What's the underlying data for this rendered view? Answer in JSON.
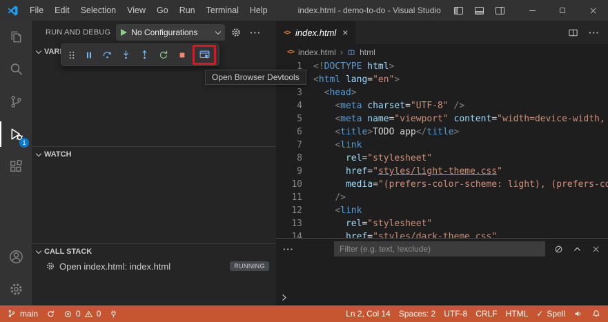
{
  "colors": {
    "status_bar_background": "#C65531",
    "badge_background": "#0A7ACC",
    "annotation_red": "#E81123"
  },
  "title_bar": {
    "app_title": "index.html - demo-to-do - Visual Studio C...",
    "menus": [
      "File",
      "Edit",
      "Selection",
      "View",
      "Go",
      "Run",
      "Terminal",
      "Help"
    ]
  },
  "activity_bar": {
    "debug_badge": "1"
  },
  "sidebar": {
    "title": "RUN AND DEBUG",
    "launch_dropdown": {
      "label": "No Configurations"
    },
    "variables_header": "VARIABLES",
    "watch_header": "WATCH",
    "call_stack_header": "CALL STACK",
    "call_stack_item": {
      "label": "Open index.html: index.html",
      "status": "RUNNING"
    }
  },
  "debug_toolbar": {
    "tooltip": "Open Browser Devtools"
  },
  "editor": {
    "tab_label": "index.html",
    "tab_close": "×",
    "breadcrumb_file": "index.html",
    "breadcrumb_separator": "›",
    "breadcrumb_symbol": "html",
    "file_icon_glyph": "<>",
    "more_actions_glyph": "···",
    "code_lines": [
      {
        "n": "1",
        "t": [
          [
            "p",
            "<!"
          ],
          [
            "tag",
            "DOCTYPE"
          ],
          [
            "txt",
            " "
          ],
          [
            "attr",
            "html"
          ],
          [
            "p",
            ">"
          ]
        ]
      },
      {
        "n": "2",
        "t": [
          [
            "p",
            "<"
          ],
          [
            "tag",
            "html"
          ],
          [
            "txt",
            " "
          ],
          [
            "attr",
            "lang"
          ],
          [
            "eq",
            "="
          ],
          [
            "str",
            "\"en\""
          ],
          [
            "p",
            ">"
          ]
        ]
      },
      {
        "n": "3",
        "t": [
          [
            "txt",
            "  "
          ],
          [
            "p",
            "<"
          ],
          [
            "tag",
            "head"
          ],
          [
            "p",
            ">"
          ]
        ]
      },
      {
        "n": "4",
        "t": [
          [
            "txt",
            "    "
          ],
          [
            "p",
            "<"
          ],
          [
            "tag",
            "meta"
          ],
          [
            "txt",
            " "
          ],
          [
            "attr",
            "charset"
          ],
          [
            "eq",
            "="
          ],
          [
            "str",
            "\"UTF-8\""
          ],
          [
            "txt",
            " "
          ],
          [
            "p",
            "/>"
          ]
        ]
      },
      {
        "n": "5",
        "t": [
          [
            "txt",
            "    "
          ],
          [
            "p",
            "<"
          ],
          [
            "tag",
            "meta"
          ],
          [
            "txt",
            " "
          ],
          [
            "attr",
            "name"
          ],
          [
            "eq",
            "="
          ],
          [
            "str",
            "\"viewport\""
          ],
          [
            "txt",
            " "
          ],
          [
            "attr",
            "content"
          ],
          [
            "eq",
            "="
          ],
          [
            "str",
            "\"width=device-width,"
          ]
        ]
      },
      {
        "n": "6",
        "t": [
          [
            "txt",
            "    "
          ],
          [
            "p",
            "<"
          ],
          [
            "tag",
            "title"
          ],
          [
            "p",
            ">"
          ],
          [
            "txt",
            "TODO app"
          ],
          [
            "p",
            "</"
          ],
          [
            "tag",
            "title"
          ],
          [
            "p",
            ">"
          ]
        ]
      },
      {
        "n": "7",
        "t": [
          [
            "txt",
            "    "
          ],
          [
            "p",
            "<"
          ],
          [
            "tag",
            "link"
          ]
        ]
      },
      {
        "n": "8",
        "t": [
          [
            "txt",
            "      "
          ],
          [
            "attr",
            "rel"
          ],
          [
            "eq",
            "="
          ],
          [
            "str",
            "\"stylesheet\""
          ]
        ]
      },
      {
        "n": "9",
        "t": [
          [
            "txt",
            "      "
          ],
          [
            "attr",
            "href"
          ],
          [
            "eq",
            "="
          ],
          [
            "str",
            "\""
          ],
          [
            "strU",
            "styles/light-theme.css"
          ],
          [
            "str",
            "\""
          ]
        ]
      },
      {
        "n": "10",
        "t": [
          [
            "txt",
            "      "
          ],
          [
            "attr",
            "media"
          ],
          [
            "eq",
            "="
          ],
          [
            "str",
            "\"(prefers-color-scheme: light), (prefers-co"
          ]
        ]
      },
      {
        "n": "11",
        "t": [
          [
            "txt",
            "    "
          ],
          [
            "p",
            "/>"
          ]
        ]
      },
      {
        "n": "12",
        "t": [
          [
            "txt",
            "    "
          ],
          [
            "p",
            "<"
          ],
          [
            "tag",
            "link"
          ]
        ]
      },
      {
        "n": "13",
        "t": [
          [
            "txt",
            "      "
          ],
          [
            "attr",
            "rel"
          ],
          [
            "eq",
            "="
          ],
          [
            "str",
            "\"stylesheet\""
          ]
        ]
      },
      {
        "n": "14",
        "t": [
          [
            "txt",
            "      "
          ],
          [
            "attr",
            "href"
          ],
          [
            "eq",
            "="
          ],
          [
            "str",
            "\""
          ],
          [
            "strU",
            "styles/dark-theme.css"
          ],
          [
            "str",
            "\""
          ]
        ]
      }
    ]
  },
  "panel": {
    "filter_placeholder": "Filter (e.g. text, !exclude)",
    "more_tabs_glyph": "···"
  },
  "status_bar": {
    "branch": "main",
    "errors": "0",
    "warnings": "0",
    "cursor": "Ln 2, Col 14",
    "indent": "Spaces: 2",
    "encoding": "UTF-8",
    "eol": "CRLF",
    "language": "HTML",
    "spell_check": "✓",
    "spell": "Spell"
  }
}
